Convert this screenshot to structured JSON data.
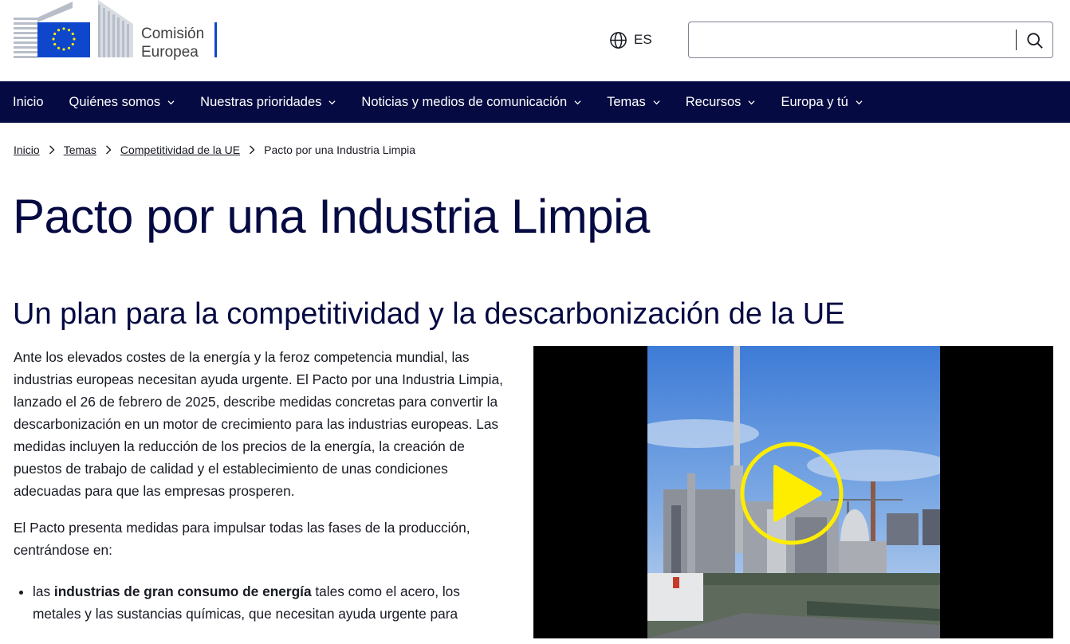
{
  "header": {
    "logo_line1": "Comisión",
    "logo_line2": "Europea",
    "language": "ES",
    "search_placeholder": ""
  },
  "nav": {
    "items": [
      {
        "label": "Inicio",
        "has_menu": false
      },
      {
        "label": "Quiénes somos",
        "has_menu": true
      },
      {
        "label": "Nuestras prioridades",
        "has_menu": true
      },
      {
        "label": "Noticias y medios de comunicación",
        "has_menu": true
      },
      {
        "label": "Temas",
        "has_menu": true
      },
      {
        "label": "Recursos",
        "has_menu": true
      },
      {
        "label": "Europa y tú",
        "has_menu": true
      }
    ]
  },
  "breadcrumb": {
    "items": [
      "Inicio",
      "Temas",
      "Competitividad de la UE"
    ],
    "current": "Pacto por una Industria Limpia"
  },
  "page": {
    "title": "Pacto por una Industria Limpia",
    "subtitle": "Un plan para la competitividad y la descarbonización de la UE",
    "paragraph1": "Ante los elevados costes de la energía y la feroz competencia mundial, las industrias europeas necesitan ayuda urgente. El Pacto por una Industria Limpia, lanzado el 26 de febrero de 2025, describe medidas concretas para convertir la descarbonización en un motor de crecimiento para las industrias europeas. Las medidas incluyen la reducción de los precios de la energía, la creación de puestos de trabajo de calidad y el establecimiento de unas condiciones adecuadas para que las empresas prosperen.",
    "paragraph2": "El Pacto presenta medidas para impulsar todas las fases de la producción, centrándose en:",
    "bullet1_prefix": "las ",
    "bullet1_bold": "industrias de gran consumo de energía",
    "bullet1_rest": " tales como el acero, los metales y las sustancias químicas, que necesitan ayuda urgente para"
  },
  "colors": {
    "nav_bg": "#050a42",
    "title": "#050a42",
    "eu_blue": "#0e47cb",
    "play": "#ffed00"
  }
}
